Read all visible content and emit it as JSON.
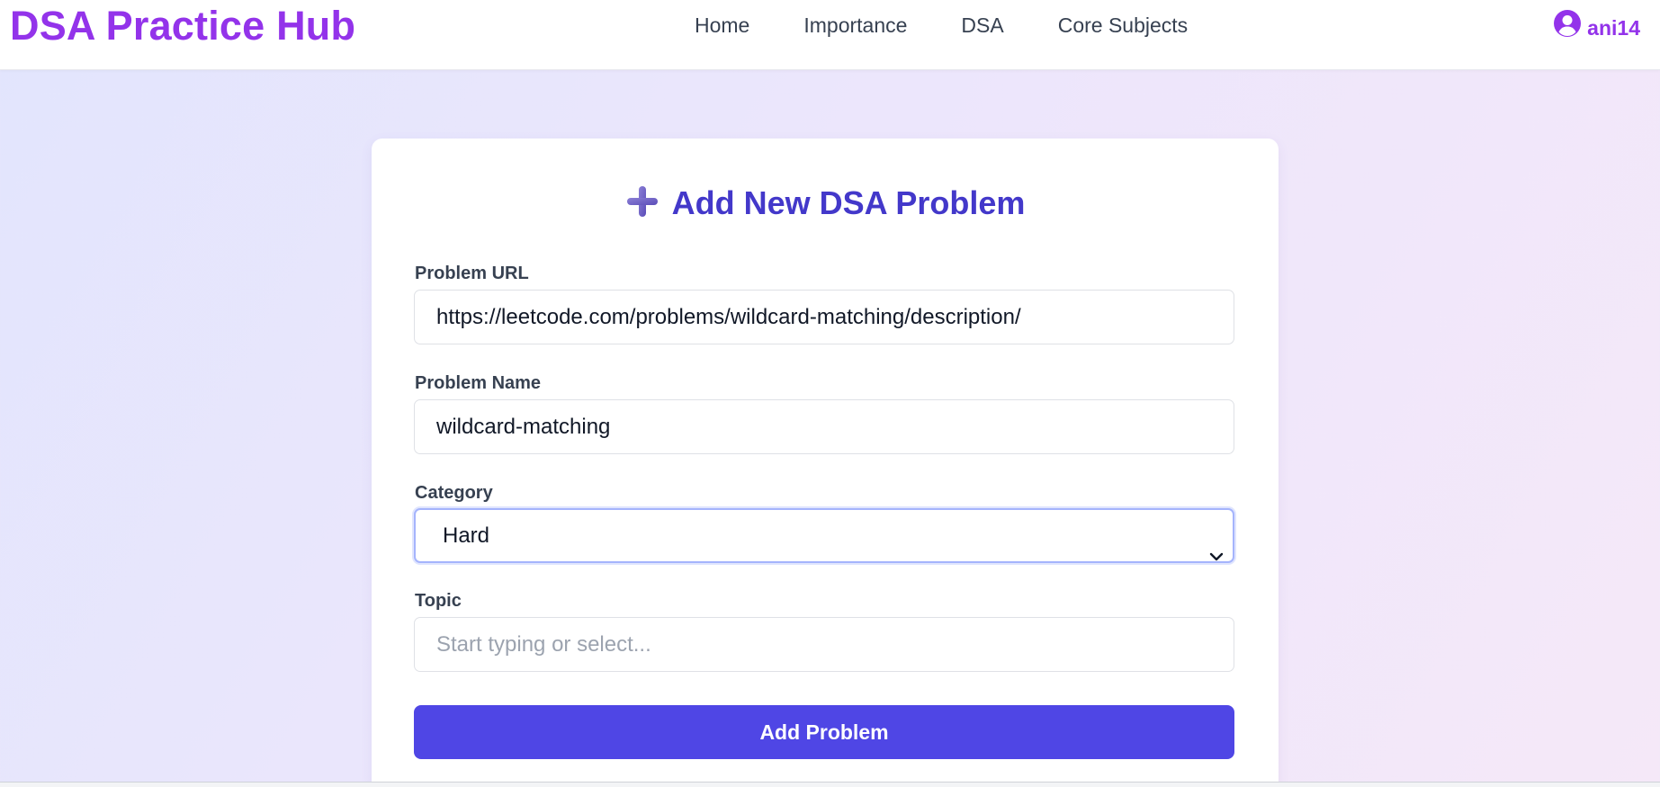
{
  "navbar": {
    "brand": "DSA Practice Hub",
    "links": [
      "Home",
      "Importance",
      "DSA",
      "Core Subjects"
    ],
    "user": "ani14",
    "user_icon": "user-circle-icon"
  },
  "form": {
    "title": "Add New DSA Problem",
    "title_icon": "plus-icon",
    "url_label": "Problem URL",
    "url_value": "https://leetcode.com/problems/wildcard-matching/description/",
    "name_label": "Problem Name",
    "name_value": "wildcard-matching",
    "category_label": "Category",
    "category_value": "Hard",
    "topic_label": "Topic",
    "topic_placeholder": "Start typing or select...",
    "submit_label": "Add Problem"
  },
  "colors": {
    "brand": "#9333ea",
    "title": "#4338ca",
    "button": "#4f46e5",
    "focus_ring": "#a5b4fc"
  }
}
